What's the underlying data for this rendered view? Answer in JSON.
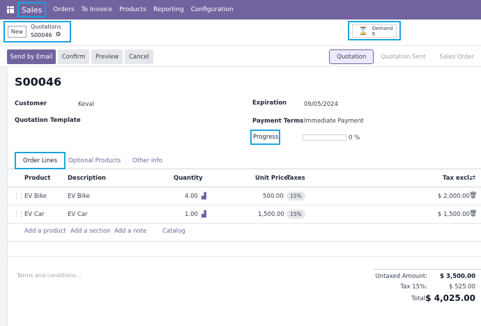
{
  "nav": {
    "brand": "Sales",
    "items": [
      "Orders",
      "To Invoice",
      "Products",
      "Reporting",
      "Configuration"
    ]
  },
  "control_panel": {
    "new_label": "New",
    "breadcrumb_parent": "Quotations",
    "breadcrumb_current": "S00046",
    "demand_label": "Demand",
    "demand_value": "6"
  },
  "actions": {
    "send_by_email": "Send by Email",
    "confirm": "Confirm",
    "preview": "Preview",
    "cancel": "Cancel"
  },
  "statusbar": [
    "Quotation",
    "Quotation Sent",
    "Sales Order"
  ],
  "form": {
    "title": "S00046",
    "customer_label": "Customer",
    "customer_value": "Keval",
    "template_label": "Quotation Template",
    "expiration_label": "Expiration",
    "expiration_value": "09/05/2024",
    "payment_terms_label": "Payment Terms",
    "payment_terms_value": "Immediate Payment",
    "progress_label": "Progress",
    "progress_value": "0 %"
  },
  "tabs": [
    "Order Lines",
    "Optional Products",
    "Other Info"
  ],
  "table": {
    "headers": {
      "product": "Product",
      "description": "Description",
      "quantity": "Quantity",
      "unit_price": "Unit Price",
      "taxes": "Taxes",
      "tax_excl": "Tax excl."
    },
    "rows": [
      {
        "product": "EV Bike",
        "description": "EV Bike",
        "quantity": "4.00",
        "unit_price": "500.00",
        "tax": "15%",
        "subtotal": "$ 2,000.00"
      },
      {
        "product": "EV Car",
        "description": "EV Car",
        "quantity": "1.00",
        "unit_price": "1,500.00",
        "tax": "15%",
        "subtotal": "$ 1,500.00"
      }
    ],
    "add_links": [
      "Add a product",
      "Add a section",
      "Add a note",
      "Catalog"
    ]
  },
  "footer": {
    "terms_placeholder": "Terms and conditions...",
    "untaxed_label": "Untaxed Amount:",
    "untaxed_value": "$ 3,500.00",
    "tax_label": "Tax 15%:",
    "tax_value": "$ 525.00",
    "total_label": "Total:",
    "total_value": "$ 4,025.00"
  },
  "colors": {
    "brand": "#71639e",
    "highlight": "#1aa3e0"
  },
  "icons": [
    "apps-grid-icon",
    "gear-icon",
    "hourglass-icon",
    "drag-handle-icon",
    "forecast-chart-icon",
    "trash-icon",
    "column-settings-icon"
  ]
}
